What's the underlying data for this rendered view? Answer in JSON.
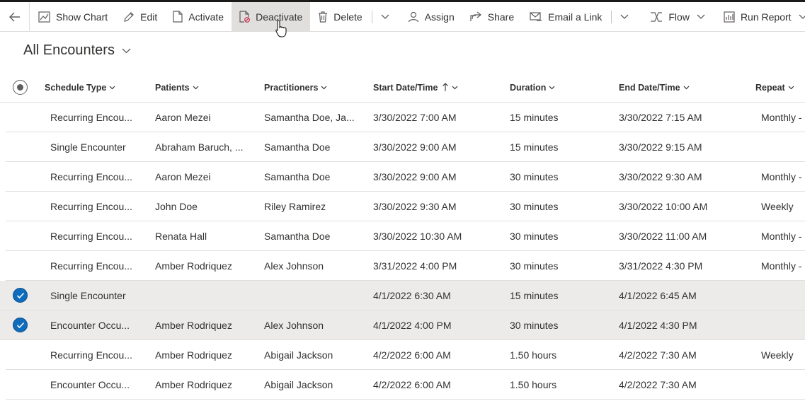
{
  "toolbar": {
    "show_chart": "Show Chart",
    "edit": "Edit",
    "activate": "Activate",
    "deactivate": "Deactivate",
    "delete": "Delete",
    "assign": "Assign",
    "share": "Share",
    "email_link": "Email a Link",
    "flow": "Flow",
    "run_report": "Run Report"
  },
  "view": {
    "title": "All Encounters"
  },
  "columns": {
    "schedule_type": "Schedule Type",
    "patients": "Patients",
    "practitioners": "Practitioners",
    "start": "Start Date/Time",
    "duration": "Duration",
    "end": "End Date/Time",
    "repeat": "Repeat"
  },
  "rows": [
    {
      "schedule_type": "Recurring Encou...",
      "patients": "Aaron Mezei",
      "practitioners": "Samantha Doe, Ja...",
      "start": "3/30/2022 7:00 AM",
      "duration": "15 minutes",
      "end": "3/30/2022 7:15 AM",
      "repeat": "Monthly -",
      "selected": false
    },
    {
      "schedule_type": "Single Encounter",
      "patients": "Abraham Baruch, ...",
      "practitioners": "Samantha Doe",
      "start": "3/30/2022 9:00 AM",
      "duration": "15 minutes",
      "end": "3/30/2022 9:15 AM",
      "repeat": "",
      "selected": false
    },
    {
      "schedule_type": "Recurring Encou...",
      "patients": "Aaron Mezei",
      "practitioners": "Samantha Doe",
      "start": "3/30/2022 9:00 AM",
      "duration": "30 minutes",
      "end": "3/30/2022 9:30 AM",
      "repeat": "Monthly -",
      "selected": false
    },
    {
      "schedule_type": "Recurring Encou...",
      "patients": "John Doe",
      "practitioners": "Riley Ramirez",
      "start": "3/30/2022 9:30 AM",
      "duration": "30 minutes",
      "end": "3/30/2022 10:00 AM",
      "repeat": "Weekly",
      "selected": false
    },
    {
      "schedule_type": "Recurring Encou...",
      "patients": "Renata Hall",
      "practitioners": "Samantha Doe",
      "start": "3/30/2022 10:30 AM",
      "duration": "30 minutes",
      "end": "3/30/2022 11:00 AM",
      "repeat": "Monthly -",
      "selected": false
    },
    {
      "schedule_type": "Recurring Encou...",
      "patients": "Amber Rodriquez",
      "practitioners": "Alex Johnson",
      "start": "3/31/2022 4:00 PM",
      "duration": "30 minutes",
      "end": "3/31/2022 4:30 PM",
      "repeat": "Monthly -",
      "selected": false
    },
    {
      "schedule_type": "Single Encounter",
      "patients": "",
      "practitioners": "",
      "start": "4/1/2022 6:30 AM",
      "duration": "15 minutes",
      "end": "4/1/2022 6:45 AM",
      "repeat": "",
      "selected": true
    },
    {
      "schedule_type": "Encounter Occu...",
      "patients": "Amber Rodriquez",
      "practitioners": "Alex Johnson",
      "start": "4/1/2022 4:00 PM",
      "duration": "30 minutes",
      "end": "4/1/2022 4:30 PM",
      "repeat": "",
      "selected": true
    },
    {
      "schedule_type": "Recurring Encou...",
      "patients": "Amber Rodriquez",
      "practitioners": "Abigail Jackson",
      "start": "4/2/2022 6:00 AM",
      "duration": "1.50 hours",
      "end": "4/2/2022 7:30 AM",
      "repeat": "Weekly",
      "selected": false
    },
    {
      "schedule_type": "Encounter Occu...",
      "patients": "Amber Rodriquez",
      "practitioners": "Abigail Jackson",
      "start": "4/2/2022 6:00 AM",
      "duration": "1.50 hours",
      "end": "4/2/2022 7:30 AM",
      "repeat": "",
      "selected": false
    }
  ],
  "colors": {
    "accent": "#0f6cbd",
    "selected_row": "#edebe9",
    "active_button": "#e1dfdd"
  }
}
